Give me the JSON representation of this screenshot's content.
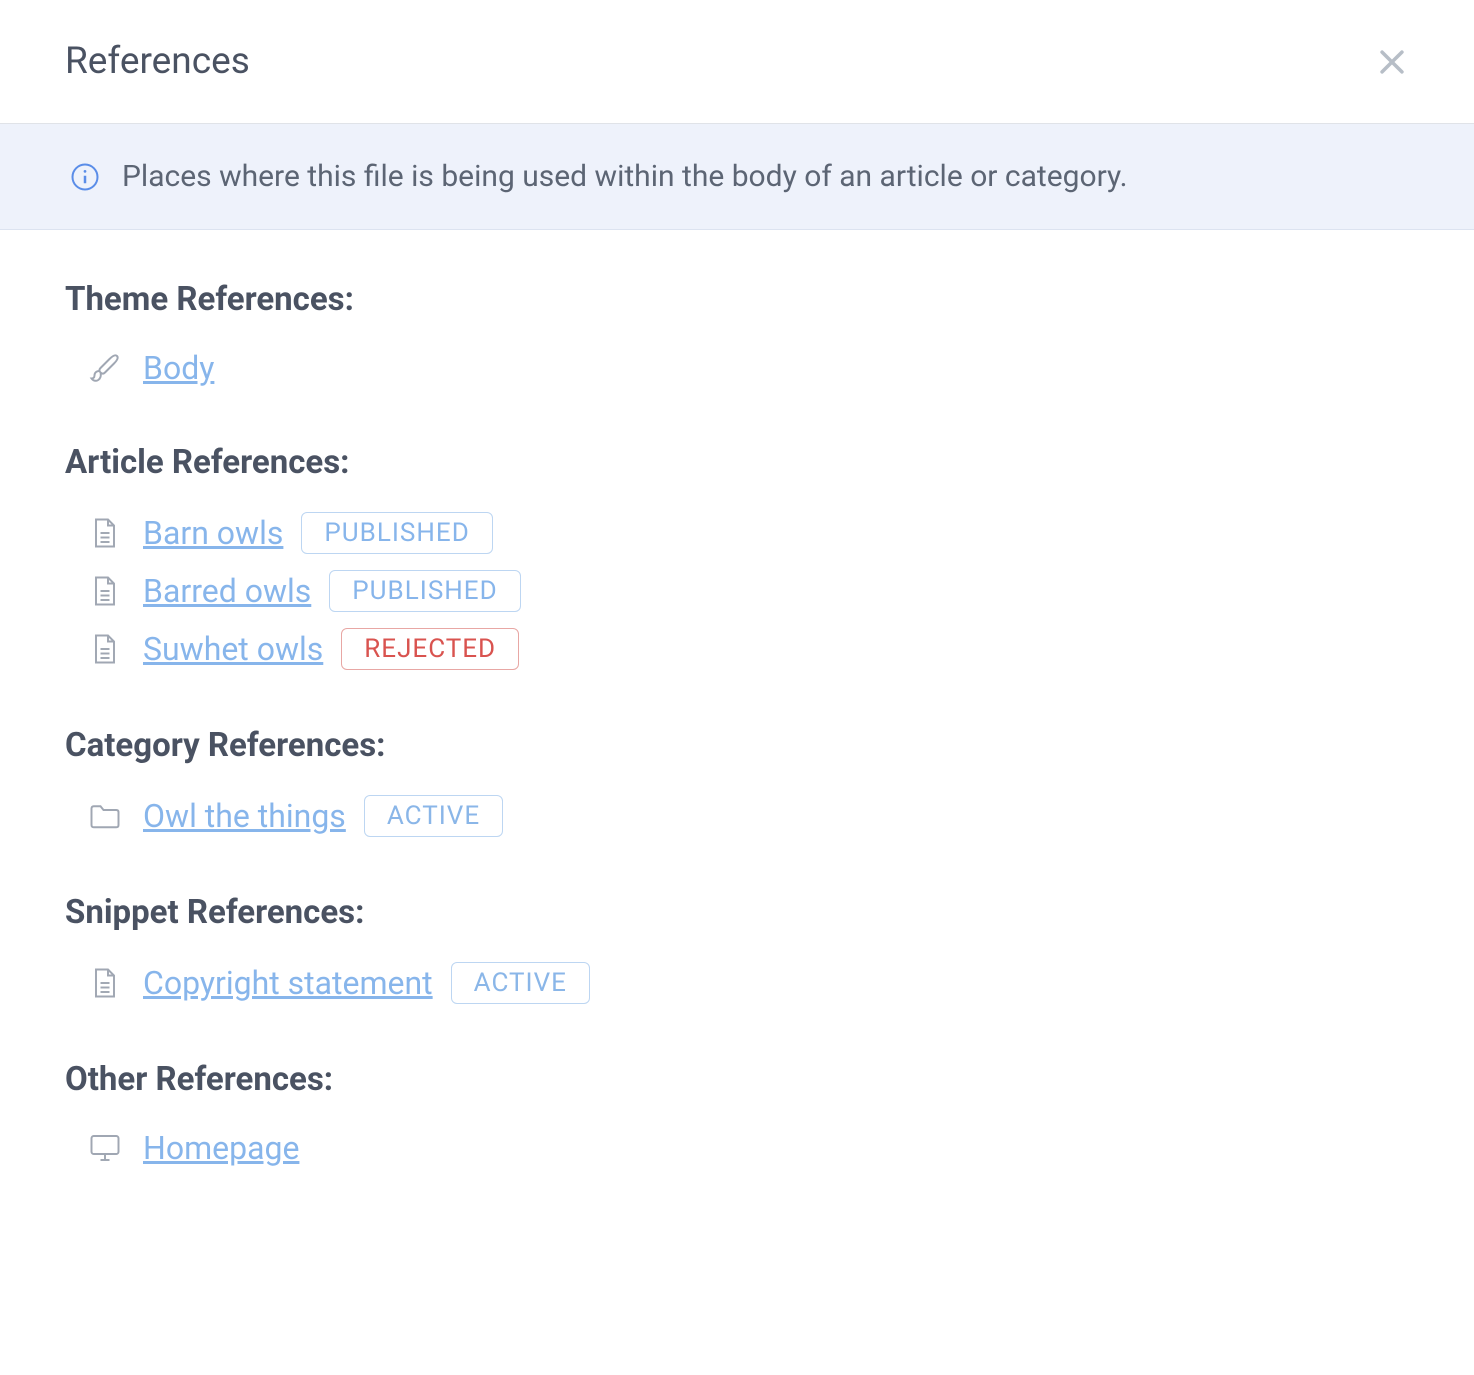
{
  "header": {
    "title": "References"
  },
  "info": {
    "text": "Places where this file is being used within the body of an article or category."
  },
  "sections": {
    "theme": {
      "title": "Theme References:",
      "items": [
        {
          "label": "Body"
        }
      ]
    },
    "article": {
      "title": "Article References:",
      "items": [
        {
          "label": "Barn owls",
          "badge": "PUBLISHED",
          "badgeType": "published"
        },
        {
          "label": "Barred owls",
          "badge": "PUBLISHED",
          "badgeType": "published"
        },
        {
          "label": "Suwhet owls",
          "badge": "REJECTED",
          "badgeType": "rejected"
        }
      ]
    },
    "category": {
      "title": "Category References:",
      "items": [
        {
          "label": "Owl the things",
          "badge": "ACTIVE",
          "badgeType": "active"
        }
      ]
    },
    "snippet": {
      "title": "Snippet References:",
      "items": [
        {
          "label": "Copyright statement",
          "badge": "ACTIVE",
          "badgeType": "active"
        }
      ]
    },
    "other": {
      "title": "Other References:",
      "items": [
        {
          "label": "Homepage"
        }
      ]
    }
  }
}
